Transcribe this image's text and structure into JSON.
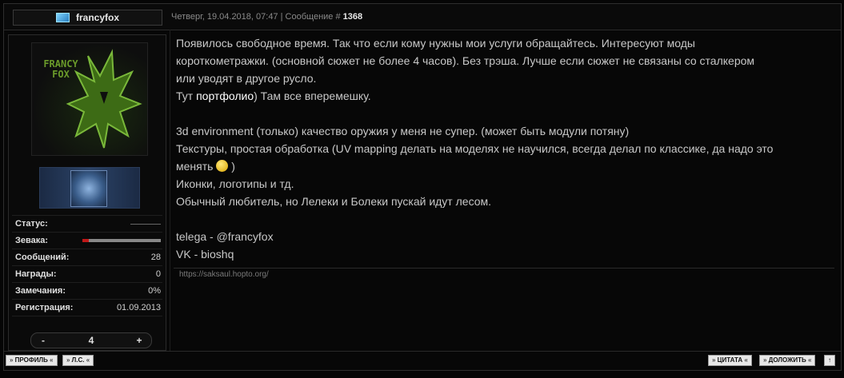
{
  "post": {
    "author": "francyfox",
    "date": "Четверг, 19.04.2018, 07:47",
    "separator": " | ",
    "message_label": "Сообщение # ",
    "message_number": "1368",
    "avatar_text_1": "FRANCY",
    "avatar_text_2": "FOX",
    "body": {
      "line1": "Появилось свободное время. Так что если кому нужны мои услуги обращайтесь. Интересуют моды",
      "line2": "короткометражки. (основной сюжет не более 4 часов). Без трэша. Лучше если сюжет не связаны со сталкером",
      "line3": "или уводят в другое русло.",
      "line4_before": "Тут ",
      "link_text": "портфолио",
      "line4_after": ") Там все вперемешку.",
      "line5": "3d environment (только) качество оружия у меня не супер. (может быть модули потяну)",
      "line6": "Текстуры, простая обработка (UV mapping делать на моделях не научился, всегда делал по классике, да надо это",
      "line7_before": "менять ",
      "line7_after": " )",
      "line8": "Иконки, логотипы и тд.",
      "line9": "Обычный любитель, но Лелеки и Болеки пускай идут лесом.",
      "line10": "telega - @francyfox",
      "line11": "VK - bioshq"
    },
    "signature": "https://saksaul.hopto.org/"
  },
  "profile": {
    "stats": [
      {
        "label": "Статус:",
        "value": ""
      },
      {
        "label": "Зевака:",
        "value": ""
      },
      {
        "label": "Сообщений:",
        "value": "28"
      },
      {
        "label": "Награды:",
        "value": "0"
      },
      {
        "label": "Замечания:",
        "value": "0%"
      },
      {
        "label": "Регистрация:",
        "value": "01.09.2013"
      }
    ],
    "reputation_fill": 0.08,
    "reputation": {
      "minus": "-",
      "value": "4",
      "plus": "+"
    }
  },
  "footer": {
    "profile": "ПРОФИЛЬ",
    "pm": "Л.С.",
    "quote": "ЦИТАТА",
    "report": "ДОЛОЖИТЬ",
    "up": "↑"
  },
  "colors": {
    "background": "#050505",
    "text": "#c8c8c8",
    "link": "#ffffff",
    "reputation_bar": "#c01818"
  }
}
